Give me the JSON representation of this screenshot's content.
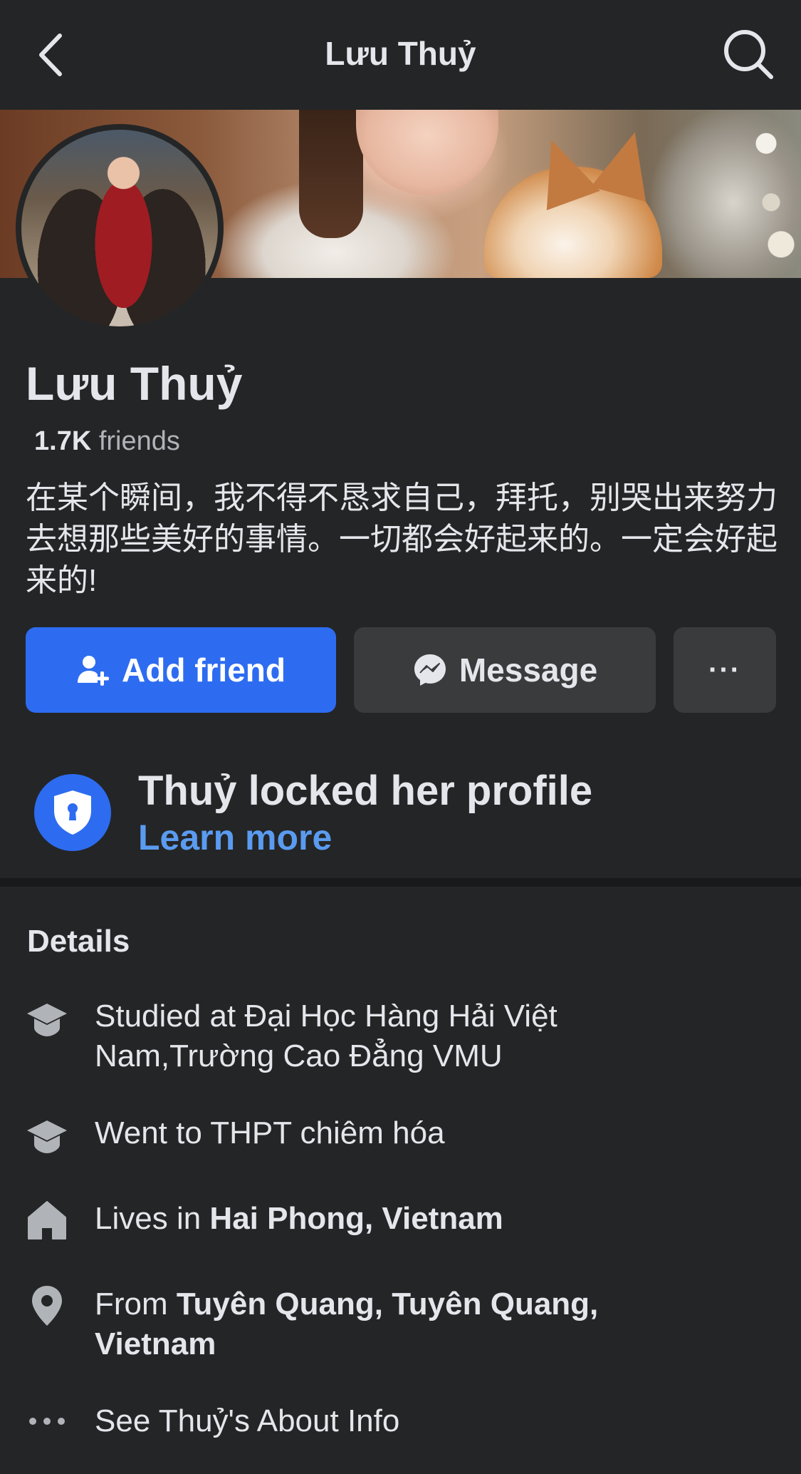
{
  "nav": {
    "title": "Lưu Thuỷ"
  },
  "profile": {
    "name": "Lưu Thuỷ",
    "friends_count": "1.7K",
    "friends_label": "friends",
    "bio": "在某个瞬间，我不得不恳求自己，拜托，别哭出来努力去想那些美好的事情。一切都会好起来的。一定会好起来的!"
  },
  "actions": {
    "add_friend": "Add friend",
    "message": "Message",
    "more": "···"
  },
  "locked": {
    "title": "Thuỷ locked her profile",
    "link": "Learn more"
  },
  "details": {
    "title": "Details",
    "studied_prefix": "Studied at Đại Học Hàng Hải Việt Nam,Trường Cao Đẳng VMU",
    "went_to": "Went to THPT chiêm hóa",
    "lives_prefix": "Lives in ",
    "lives_place": "Hai Phong, Vietnam",
    "from_prefix": "From ",
    "from_place": "Tuyên Quang, Tuyên Quang, Vietnam",
    "see_about": "See Thuỷ's About Info"
  },
  "colors": {
    "background": "#242526",
    "accent": "#2d6cf0",
    "link": "#5a9bf0",
    "secondary_button": "#3a3b3c"
  }
}
